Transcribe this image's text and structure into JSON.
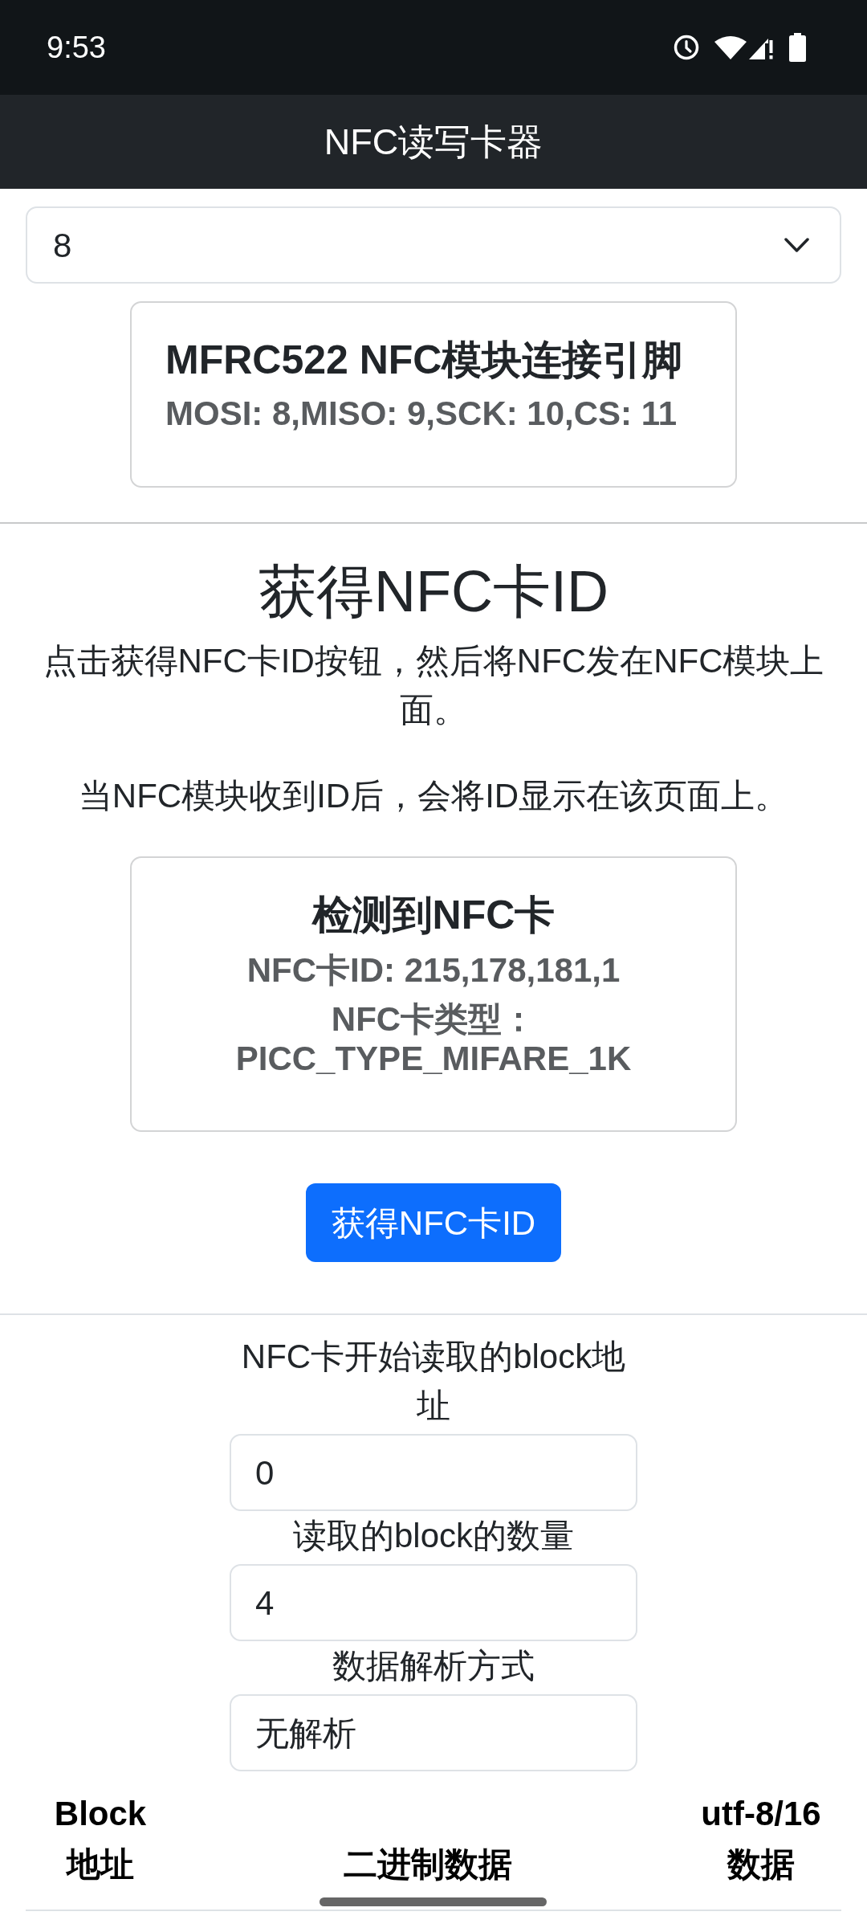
{
  "status_bar": {
    "time": "9:53"
  },
  "app_bar": {
    "title": "NFC读写卡器"
  },
  "pin_select": {
    "value": "8"
  },
  "pin_card": {
    "title": "MFRC522 NFC模块连接引脚",
    "subtitle": "MOSI: 8,MISO: 9,SCK: 10,CS: 11"
  },
  "card_id_section": {
    "heading": "获得NFC卡ID",
    "paragraphs": [
      "点击获得NFC卡ID按钮，然后将NFC发在NFC模块上面。",
      "当NFC模块收到ID后，会将ID显示在该页面上。"
    ],
    "result_card": {
      "title": "检测到NFC卡",
      "lines": [
        "NFC卡ID: 215,178,181,1",
        "NFC卡类型：PICC_TYPE_MIFARE_1K"
      ]
    },
    "button": "获得NFC卡ID"
  },
  "read_form": {
    "fields": [
      {
        "label": "NFC卡开始读取的block地址",
        "value": "0"
      },
      {
        "label": "读取的block的数量",
        "value": "4"
      },
      {
        "label": "数据解析方式",
        "value": "无解析"
      }
    ]
  },
  "table": {
    "columns": [
      "Block 地址",
      "二进制数据",
      "utf-8/16 数据"
    ]
  }
}
